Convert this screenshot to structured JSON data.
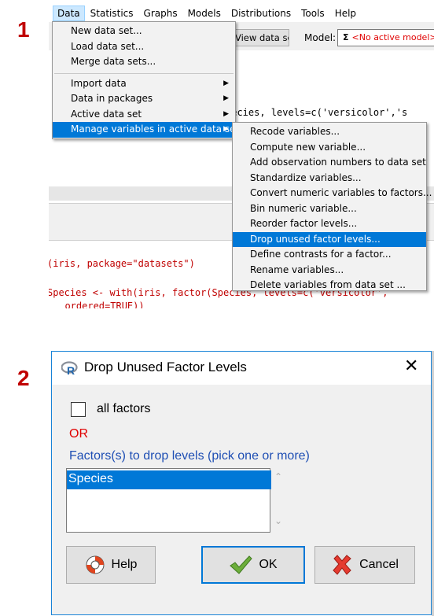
{
  "steps": {
    "one": "1",
    "two": "2"
  },
  "rcmdr": {
    "menubar": [
      "Data",
      "Statistics",
      "Graphs",
      "Models",
      "Distributions",
      "Tools",
      "Help"
    ],
    "toolbar": {
      "view_data_set": "View data set",
      "model_label": "Model:",
      "model_sigma": "Σ",
      "model_value": "<No active model>"
    },
    "script_line": "pecies, levels=c('versicolor','s",
    "output_line_1": "(iris, package=\"datasets\")",
    "output_line_2": "Species <- with(iris, factor(Species, levels=c('versicolor',",
    "output_line_3": "  ordered=TRUE))",
    "data_menu": {
      "items": [
        "New data set...",
        "Load data set...",
        "Merge data sets...",
        "Import data",
        "Data in packages",
        "Active data set",
        "Manage variables in active data set"
      ],
      "arrow": "▶"
    },
    "manage_menu": {
      "items": [
        "Recode variables...",
        "Compute new variable...",
        "Add observation numbers to data set",
        "Standardize variables...",
        "Convert numeric variables to factors...",
        "Bin numeric variable...",
        "Reorder factor levels...",
        "Drop unused factor levels...",
        "Define contrasts for a factor...",
        "Rename variables...",
        "Delete variables from data set ..."
      ],
      "highlighted": "Drop unused factor levels..."
    }
  },
  "dialog": {
    "title": "Drop Unused Factor Levels",
    "close": "✕",
    "all_factors_label": "all factors",
    "all_factors_checked": false,
    "or_label": "OR",
    "factors_label": "Factors(s) to drop levels (pick one or more)",
    "factors": [
      "Species"
    ],
    "selected_factor": "Species",
    "scroll_up": "⌃",
    "scroll_down": "⌄",
    "buttons": {
      "help": "Help",
      "ok": "OK",
      "cancel": "Cancel"
    },
    "colors": {
      "or": "#e00000",
      "label": "#1f4fb4",
      "selection": "#0078d7"
    }
  }
}
